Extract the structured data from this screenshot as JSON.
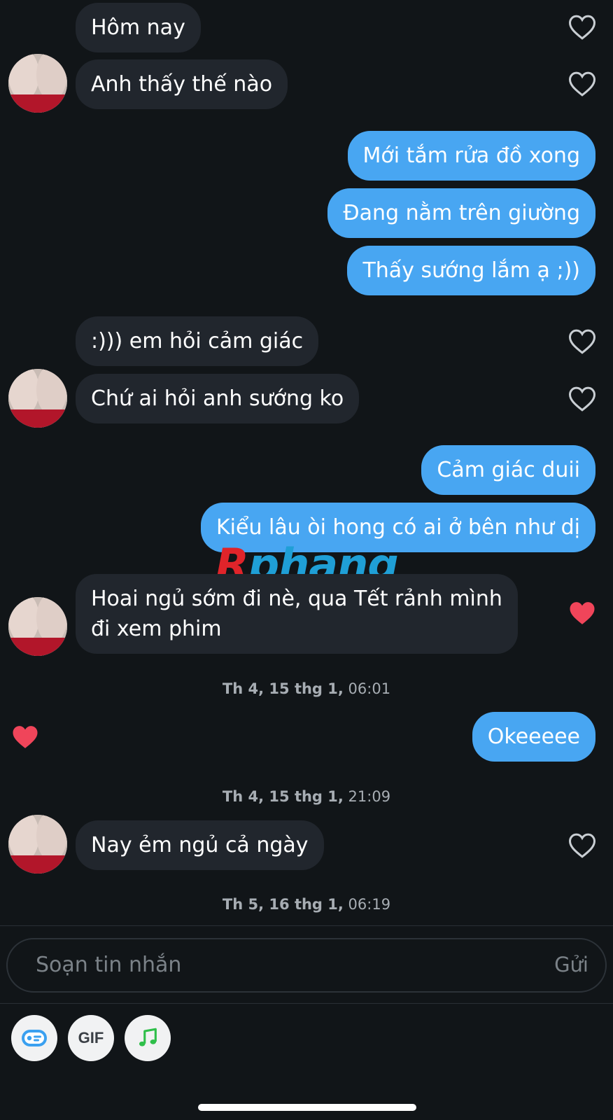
{
  "messages": [
    {
      "id": "m1",
      "dir": "in",
      "text": "Hôm nay",
      "liked": false
    },
    {
      "id": "m2",
      "dir": "in",
      "text": "Anh thấy thế nào",
      "liked": false
    },
    {
      "id": "m3",
      "dir": "out",
      "text": "Mới tắm rửa đồ xong"
    },
    {
      "id": "m4",
      "dir": "out",
      "text": "Đang nằm trên giường"
    },
    {
      "id": "m5",
      "dir": "out",
      "text": "Thấy sướng lắm ạ ;))"
    },
    {
      "id": "m6",
      "dir": "in",
      "text": ":))) em hỏi cảm giác",
      "liked": false
    },
    {
      "id": "m7",
      "dir": "in",
      "text": "Chứ ai hỏi anh sướng ko",
      "liked": false
    },
    {
      "id": "m8",
      "dir": "out",
      "text": "Cảm giác duii"
    },
    {
      "id": "m9",
      "dir": "out",
      "text": "Kiểu lâu òi hong có ai ở bên như dị"
    },
    {
      "id": "m10",
      "dir": "in",
      "line1": "Hoai ngủ sớm đi nè, qua Tết rảnh mình",
      "line2": "đi xem phim",
      "liked": true
    },
    {
      "id": "m11",
      "dir": "out",
      "text": "Okeeeee",
      "liked": true
    },
    {
      "id": "m12",
      "dir": "in",
      "text": "Nay ẻm ngủ cả ngày",
      "liked": false
    }
  ],
  "timestamps": [
    {
      "bold": "Th 4, 15 thg 1,",
      "time": " 06:01"
    },
    {
      "bold": "Th 4, 15 thg 1,",
      "time": " 21:09"
    },
    {
      "bold": "Th 5, 16 thg 1,",
      "time": " 06:19"
    }
  ],
  "watermark": {
    "first": "R",
    "rest": "phang"
  },
  "composer": {
    "placeholder": "Soạn tin nhắn",
    "send_label": "Gửi"
  },
  "toolbar": {
    "gif_label": "GIF",
    "sticker_icon": "sticker-icon",
    "music_icon": "music-icon"
  },
  "colors": {
    "background": "#111518",
    "incoming_bubble": "#21262d",
    "outgoing_bubble": "#48a6f2",
    "heart_liked": "#f0455a",
    "heart_outline": "#c9ced3"
  }
}
